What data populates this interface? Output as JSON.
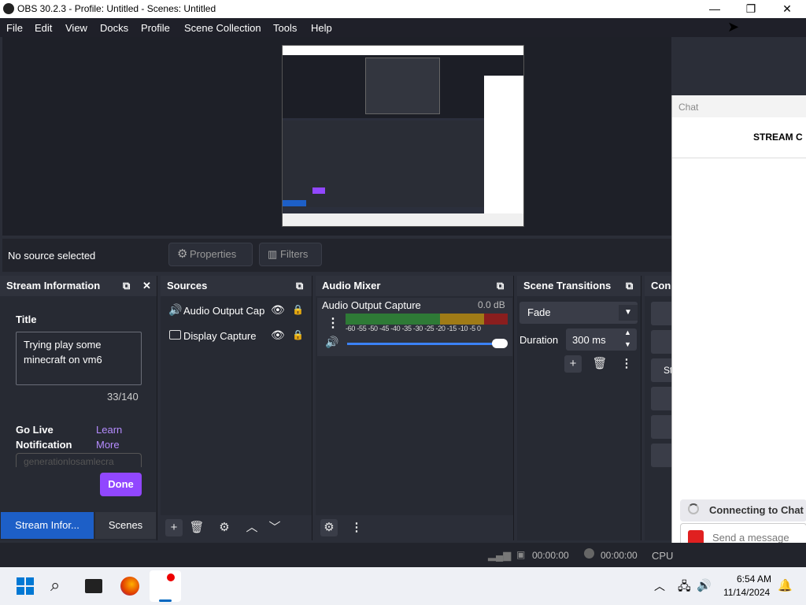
{
  "titlebar": {
    "title": "OBS 30.2.3 - Profile: Untitled - Scenes: Untitled"
  },
  "menu": [
    "File",
    "Edit",
    "View",
    "Docks",
    "Profile",
    "Scene Collection",
    "Tools",
    "Help"
  ],
  "controls": {
    "no_source": "No source selected",
    "properties": "Properties",
    "filters": "Filters"
  },
  "stream_info": {
    "header": "Stream Information",
    "title_label": "Title",
    "title_value": "Trying play some minecraft on vm6",
    "char_count": "33/140",
    "go_live_label": "Go Live Notification",
    "learn_more": "Learn More",
    "notification_placeholder": "generationlosamlecra",
    "done": "Done",
    "tab_stream": "Stream Infor...",
    "tab_scenes": "Scenes"
  },
  "sources": {
    "header": "Sources",
    "items": [
      {
        "label": "Audio Output Cap"
      },
      {
        "label": "Display Capture"
      }
    ]
  },
  "audio_mixer": {
    "header": "Audio Mixer",
    "channel_name": "Audio Output Capture",
    "level": "0.0 dB",
    "scale": [
      "-60",
      "-55",
      "-50",
      "-45",
      "-40",
      "-35",
      "-30",
      "-25",
      "-20",
      "-15",
      "-10",
      "-5",
      "0"
    ]
  },
  "transitions": {
    "header": "Scene Transitions",
    "selected": "Fade",
    "duration_label": "Duration",
    "duration_value": "300 ms"
  },
  "controls_dock": {
    "header": "Con",
    "button_label": "St"
  },
  "chat": {
    "header": "Chat",
    "title": "STREAM C",
    "connecting": "Connecting to Chat",
    "send_placeholder": "Send a message"
  },
  "status": {
    "timer1": "00:00:00",
    "timer2": "00:00:00",
    "cpu": "CPU"
  },
  "taskbar": {
    "time": "6:54 AM",
    "date": "11/14/2024"
  },
  "colors": {
    "accent_purple": "#9147ff",
    "tab_active": "#1d5fc7",
    "chat_red": "#e02020"
  }
}
